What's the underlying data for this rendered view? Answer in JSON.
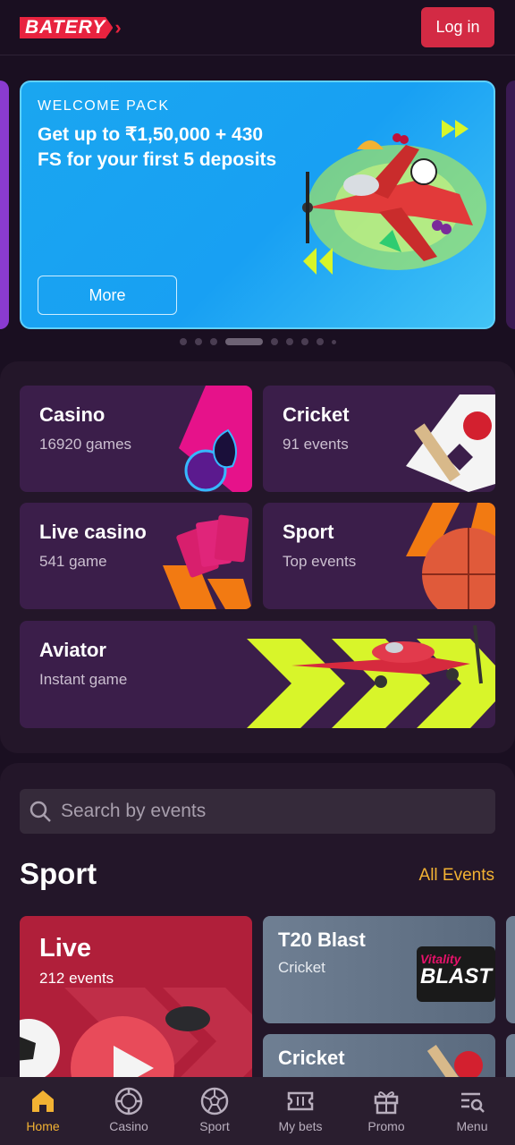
{
  "header": {
    "logo_text": "BATERY",
    "login_label": "Log in"
  },
  "banner": {
    "kicker": "WELCOME PACK",
    "headline": "Get up to ₹1,50,000 + 430 FS for your first 5 deposits",
    "more_label": "More",
    "slide_count": 9,
    "active_slide": 4
  },
  "categories": [
    {
      "title": "Casino",
      "subtitle": "16920 games"
    },
    {
      "title": "Cricket",
      "subtitle": "91 events"
    },
    {
      "title": "Live casino",
      "subtitle": "541 game"
    },
    {
      "title": "Sport",
      "subtitle": "Top events"
    },
    {
      "title": "Aviator",
      "subtitle": "Instant game"
    }
  ],
  "search": {
    "placeholder": "Search by events"
  },
  "sport": {
    "heading": "Sport",
    "all_events": "All Events",
    "live": {
      "title": "Live",
      "subtitle": "212 events"
    },
    "events": [
      {
        "title": "T20 Blast",
        "subtitle": "Cricket",
        "logo_top": "Vitality",
        "logo_bottom": "BLAST"
      },
      {
        "title": "Cricket",
        "subtitle": ""
      }
    ]
  },
  "bottom_nav": [
    {
      "label": "Home",
      "icon": "home-icon",
      "active": true
    },
    {
      "label": "Casino",
      "icon": "casino-chip-icon",
      "active": false
    },
    {
      "label": "Sport",
      "icon": "football-icon",
      "active": false
    },
    {
      "label": "My bets",
      "icon": "ticket-icon",
      "active": false
    },
    {
      "label": "Promo",
      "icon": "gift-icon",
      "active": false
    },
    {
      "label": "Menu",
      "icon": "menu-search-icon",
      "active": false
    }
  ],
  "colors": {
    "background": "#1a0f21",
    "brand_red": "#e8233f",
    "accent_yellow": "#f2b233",
    "tile_purple": "#3b1e4a",
    "banner_blue": "#1aa6f0",
    "lime": "#d8f52a"
  }
}
